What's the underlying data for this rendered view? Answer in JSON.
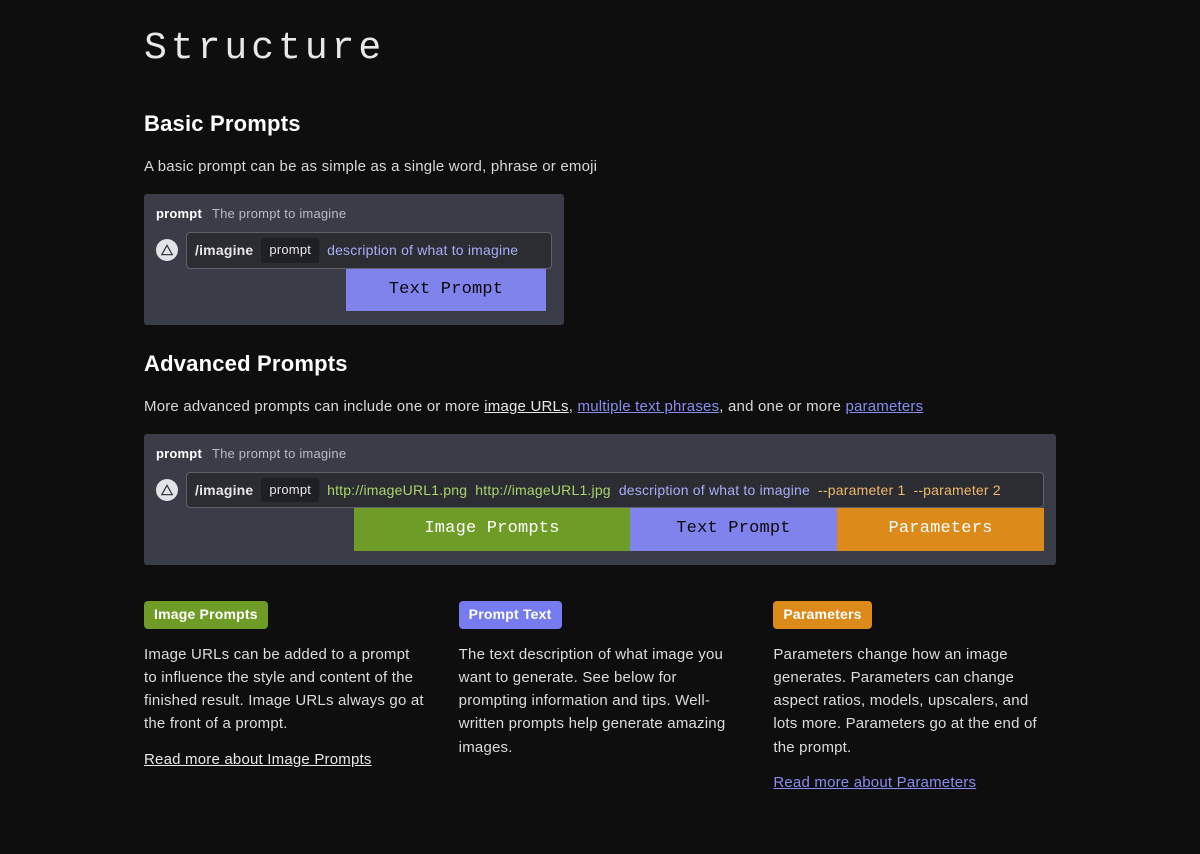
{
  "title": "Structure",
  "basic": {
    "heading": "Basic Prompts",
    "lead": "A basic prompt can be as simple as a single word, phrase or emoji",
    "prompt_kw": "prompt",
    "prompt_desc": "The prompt to imagine",
    "slash_cmd": "/imagine",
    "chip": "prompt",
    "placeholder": "description of what to imagine",
    "label_text": "Text Prompt"
  },
  "advanced": {
    "heading": "Advanced Prompts",
    "lead_pre": "More advanced prompts can include one or more ",
    "link1": "image URLs",
    "mid1": ", ",
    "link2": "multiple text phrases",
    "mid2": ", and one or more ",
    "link3": "parameters",
    "prompt_kw": "prompt",
    "prompt_desc": "The prompt to imagine",
    "slash_cmd": "/imagine",
    "chip": "prompt",
    "url1": "http://imageURL1.png",
    "url2": "http://imageURL1.jpg",
    "placeholder": "description of what to imagine",
    "param1": "--parameter 1",
    "param2": "--parameter 2",
    "label_img": "Image Prompts",
    "label_text": "Text Prompt",
    "label_par": "Parameters"
  },
  "cols": {
    "c1": {
      "badge": "Image Prompts",
      "body": "Image URLs can be added to a prompt to influence the style and content of the finished result. Image URLs always go at the front of a prompt.",
      "link": "Read more about Image Prompts"
    },
    "c2": {
      "badge": "Prompt Text",
      "body": "The text description of what image you want to generate. See below for prompting information and tips. Well-written prompts help generate amazing images."
    },
    "c3": {
      "badge": "Parameters",
      "body": "Parameters change how an image generates. Parameters can change aspect ratios, models, upscalers, and lots more. Parameters go at the end of the prompt.",
      "link": "Read more about Parameters"
    }
  }
}
